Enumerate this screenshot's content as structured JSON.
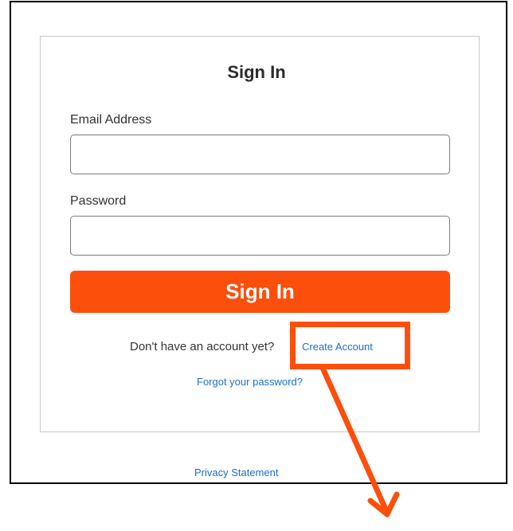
{
  "signin": {
    "title": "Sign In",
    "email_label": "Email Address",
    "email_value": "",
    "password_label": "Password",
    "password_value": "",
    "button_label": "Sign In",
    "no_account_text": "Don't have an account yet?",
    "create_account_link": "Create Account",
    "forgot_password_link": "Forgot your password?"
  },
  "footer": {
    "privacy_link": "Privacy Statement"
  },
  "annotation": {
    "highlight_color": "#fc4f0b",
    "target": "create-account-link"
  },
  "colors": {
    "accent": "#fc4f0b",
    "link": "#1a6fd1"
  }
}
